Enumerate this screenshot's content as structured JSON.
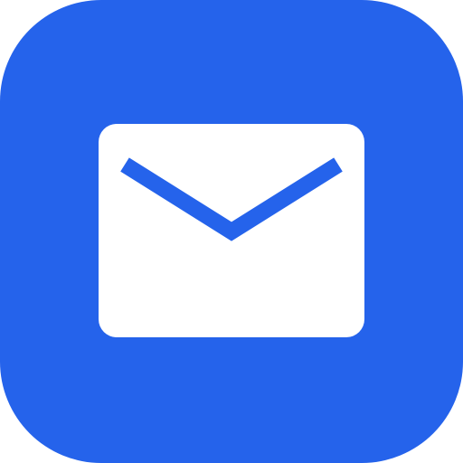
{
  "app_icon": {
    "icon": "mail-icon",
    "background_color": "#2563eb",
    "glyph_color": "#ffffff"
  }
}
